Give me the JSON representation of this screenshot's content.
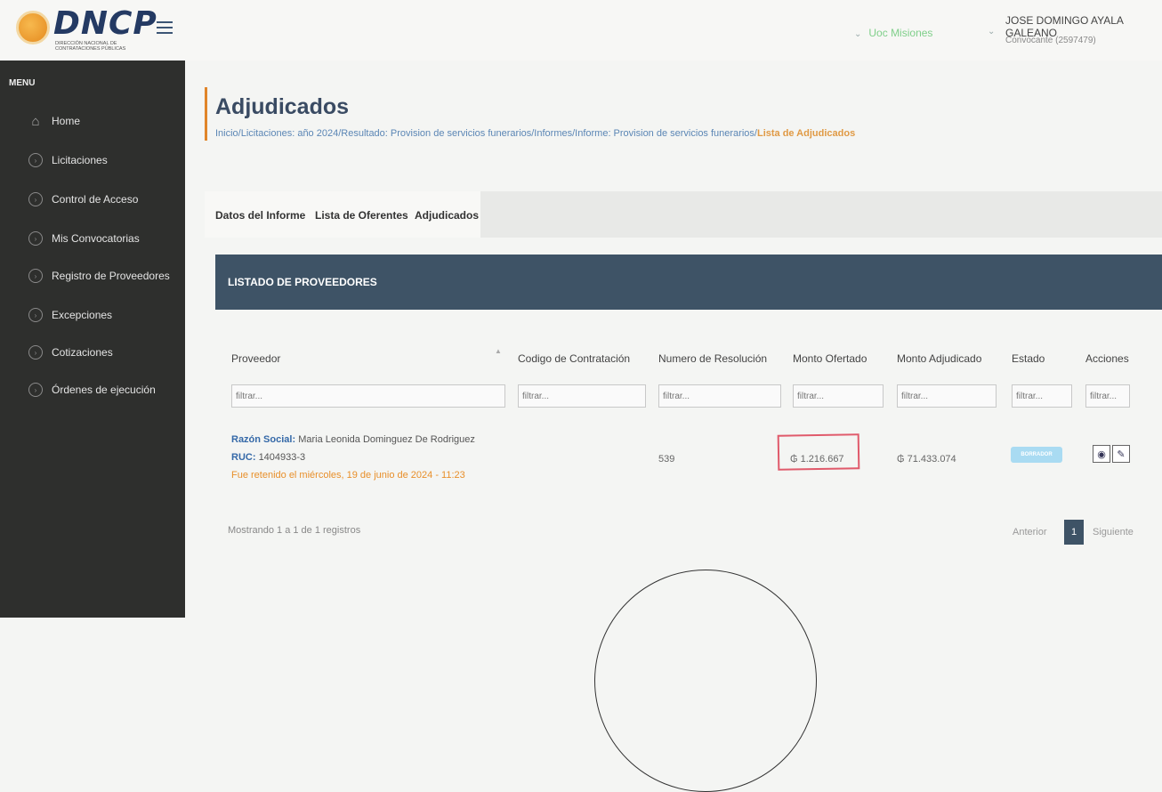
{
  "header": {
    "logo_text": "DNCP",
    "logo_subtitle": "DIRECCIÓN NACIONAL DE CONTRATACIONES PÚBLICAS",
    "location": "Uoc Misiones",
    "user_name": "JOSE DOMINGO AYALA GALEANO",
    "user_role": "Convocante (2597479)"
  },
  "sidebar": {
    "title": "MENU",
    "items": [
      {
        "label": "Home",
        "icon": "home-icon"
      },
      {
        "label": "Licitaciones",
        "icon": "chevron-circle-icon"
      },
      {
        "label": "Control de Acceso",
        "icon": "chevron-circle-icon"
      },
      {
        "label": "Mis Convocatorias",
        "icon": "chevron-circle-icon"
      },
      {
        "label": "Registro de Proveedores",
        "icon": "chevron-circle-icon"
      },
      {
        "label": "Excepciones",
        "icon": "chevron-circle-icon"
      },
      {
        "label": "Cotizaciones",
        "icon": "chevron-circle-icon"
      },
      {
        "label": "Órdenes de ejecución",
        "icon": "chevron-circle-icon"
      }
    ]
  },
  "page": {
    "title": "Adjudicados",
    "breadcrumb_path": "Inicio/Licitaciones: año 2024/Resultado: Provision de servicios funerarios/Informes/Informe: Provision de servicios funerarios/",
    "breadcrumb_current": "Lista de Adjudicados"
  },
  "tabs": [
    {
      "label": "Datos del Informe"
    },
    {
      "label": "Lista de Oferentes"
    },
    {
      "label": "Adjudicados"
    }
  ],
  "panel": {
    "title": "LISTADO DE PROVEEDORES"
  },
  "table": {
    "headers": [
      "Proveedor",
      "Codigo de Contratación",
      "Numero de Resolución",
      "Monto Ofertado",
      "Monto Adjudicado",
      "Estado",
      "Acciones"
    ],
    "filter_placeholder": "filtrar...",
    "rows": [
      {
        "razon_label": "Razón Social:",
        "razon_value": "Maria Leonida Dominguez De Rodriguez",
        "ruc_label": "RUC:",
        "ruc_value": "1404933-3",
        "retenido": "Fue retenido el miércoles, 19 de junio de 2024 - 11:23",
        "codigo": "",
        "resolucion": "539",
        "monto_ofertado": "₲ 1.216.667",
        "monto_adjudicado": "₲ 71.433.074",
        "estado": "BORRADOR"
      }
    ]
  },
  "footer": {
    "info": "Mostrando 1 a 1 de 1 registros",
    "prev": "Anterior",
    "page": "1",
    "next": "Siguiente"
  },
  "colors": {
    "accent": "#e0852a",
    "panel": "#3e5366",
    "sidebar": "#2e2f2d",
    "highlight": "#e05a6b"
  }
}
